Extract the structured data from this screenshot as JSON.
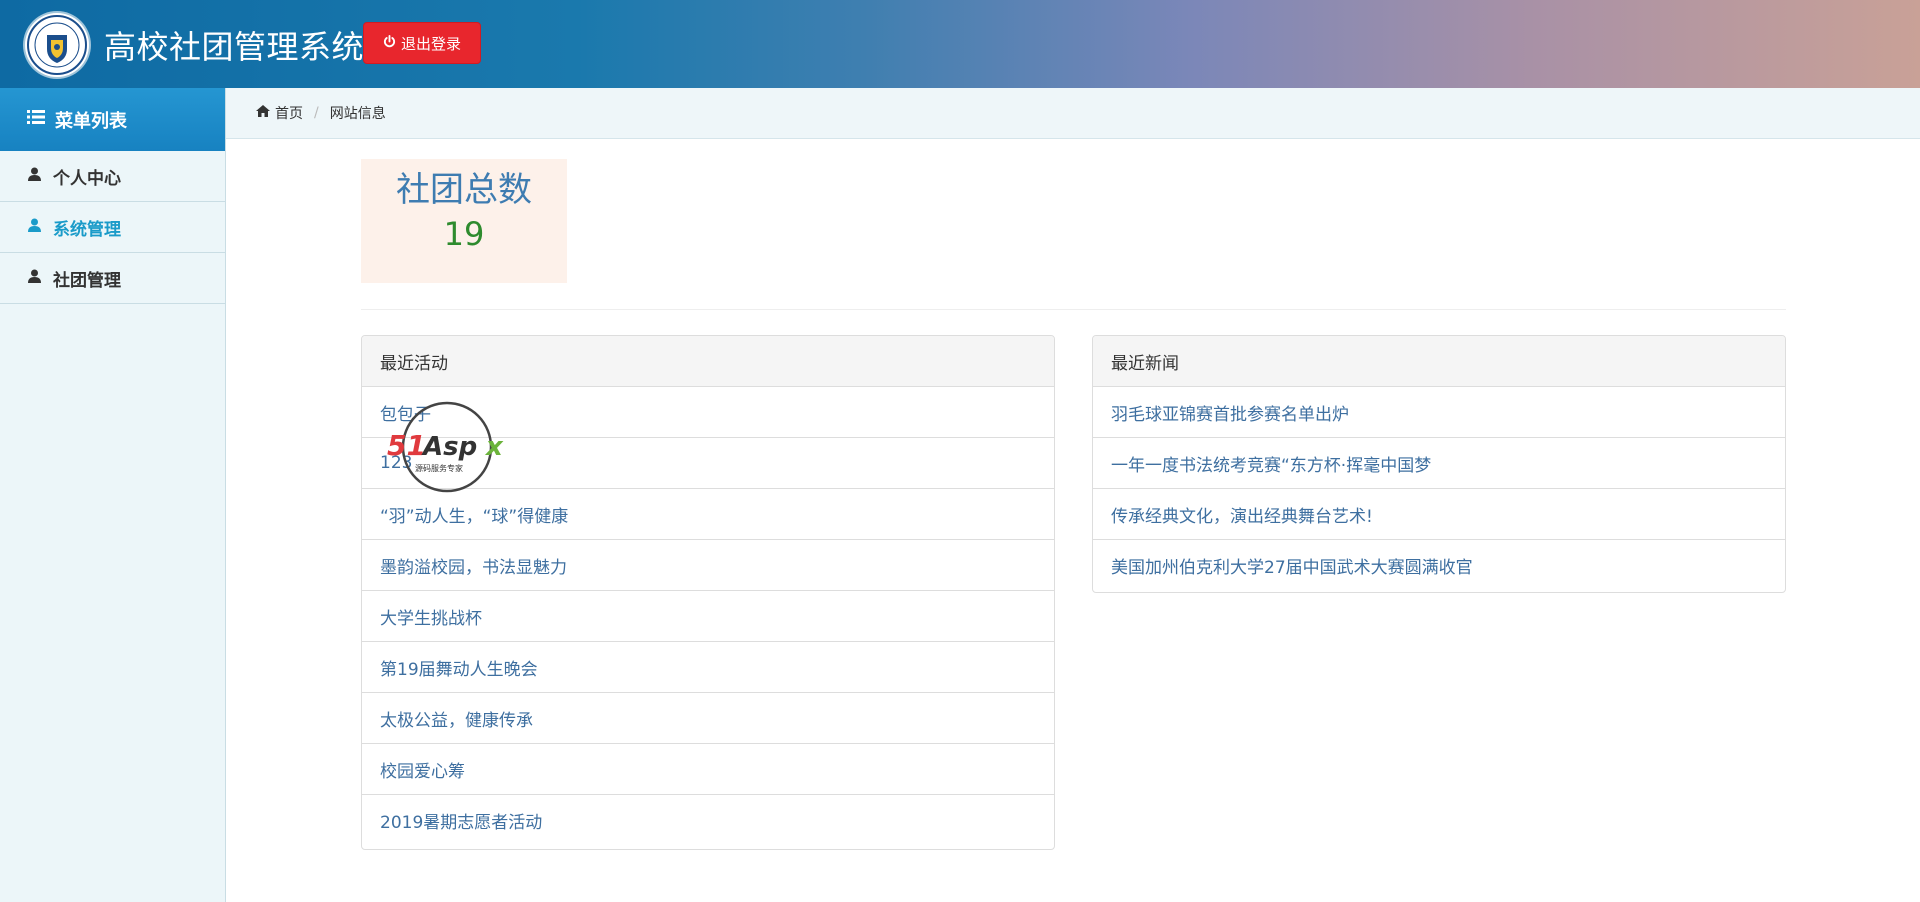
{
  "app": {
    "title": "高校社团管理系统",
    "logout_label": "退出登录",
    "accent_color": "#1d8bca",
    "logout_color": "#e8262d"
  },
  "sidebar": {
    "header": "菜单列表",
    "items": [
      {
        "label": "个人中心",
        "icon": "user-icon",
        "active": false
      },
      {
        "label": "系统管理",
        "icon": "user-icon",
        "active": true
      },
      {
        "label": "社团管理",
        "icon": "user-icon",
        "active": false
      }
    ]
  },
  "breadcrumb": {
    "home": "首页",
    "current": "网站信息"
  },
  "stats": {
    "title": "社团总数",
    "value": "19"
  },
  "activities": {
    "heading": "最近活动",
    "items": [
      "包包子",
      "123",
      "“羽”动人生，“球”得健康",
      "墨韵溢校园，书法显魅力",
      "大学生挑战杯",
      "第19届舞动人生晚会",
      "太极公益，健康传承",
      "校园爱心筹",
      "2019暑期志愿者活动"
    ]
  },
  "news": {
    "heading": "最近新闻",
    "items": [
      "羽毛球亚锦赛首批参赛名单出炉",
      "一年一度书法统考竞赛“东方杯·挥毫中国梦",
      "传承经典文化，演出经典舞台艺术!",
      "美国加州伯克利大学27届中国武术大赛圆满收官"
    ]
  },
  "watermark": {
    "brand": "51Aspx",
    "tagline": "源码服务专家"
  }
}
